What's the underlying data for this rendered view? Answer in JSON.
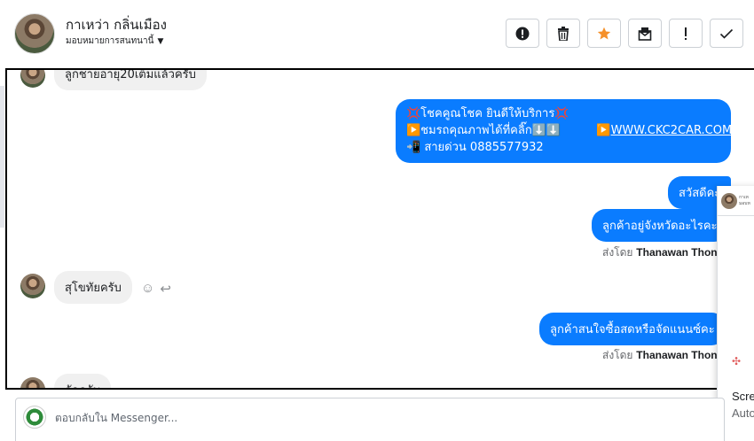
{
  "header": {
    "contact_name": "กาเหว่า กลิ่นเมือง",
    "assign_label": "มอบหมายการสนทนานี้",
    "actions": [
      {
        "name": "spam",
        "glyph": "⚠"
      },
      {
        "name": "delete",
        "glyph": "🗑"
      },
      {
        "name": "star",
        "glyph": "★"
      },
      {
        "name": "mark-unread",
        "glyph": "✉"
      },
      {
        "name": "follow-up",
        "glyph": "!"
      },
      {
        "name": "done",
        "glyph": "✓"
      }
    ]
  },
  "thread": {
    "msg_top_partial": "ลูกชายอายุ20เต็มแล้วครับ",
    "promo": {
      "line1": "💢โชคคูณโชค ยินดีให้บริการ💢",
      "line2": "▶️ชมรถคุณภาพได้ที่คลิ๊ก⬇️⬇️",
      "link_prefix": "▶️",
      "link": "WWW.CKC2CAR.COM",
      "line3": "📲 สายด่วน 0885577932"
    },
    "msg_hello": "สวัสดีคะ",
    "msg_province": "ลูกค้าอยู่จังหวัดอะไรคะ",
    "sent_by_prefix": "ส่งโดย",
    "sent_by_name": "Thanawan Thon",
    "msg_sukhothai": "สุโขทัยครับ",
    "msg_finance": "ลูกค้าสนใจซื้อสดหรือจัดแนนซ์คะ",
    "msg_bottom_partial": "จัดครับ"
  },
  "side_panel": {
    "card_text_1": "กาเห",
    "card_text_2": "มอบห",
    "text_line1": "Scre",
    "text_line2": "Auto"
  },
  "composer": {
    "placeholder": "ตอบกลับใน Messenger..."
  },
  "colors": {
    "outgoing_bubble": "#0a7cff",
    "incoming_bubble": "#f0f0f0",
    "star_accent": "#f5902a"
  }
}
